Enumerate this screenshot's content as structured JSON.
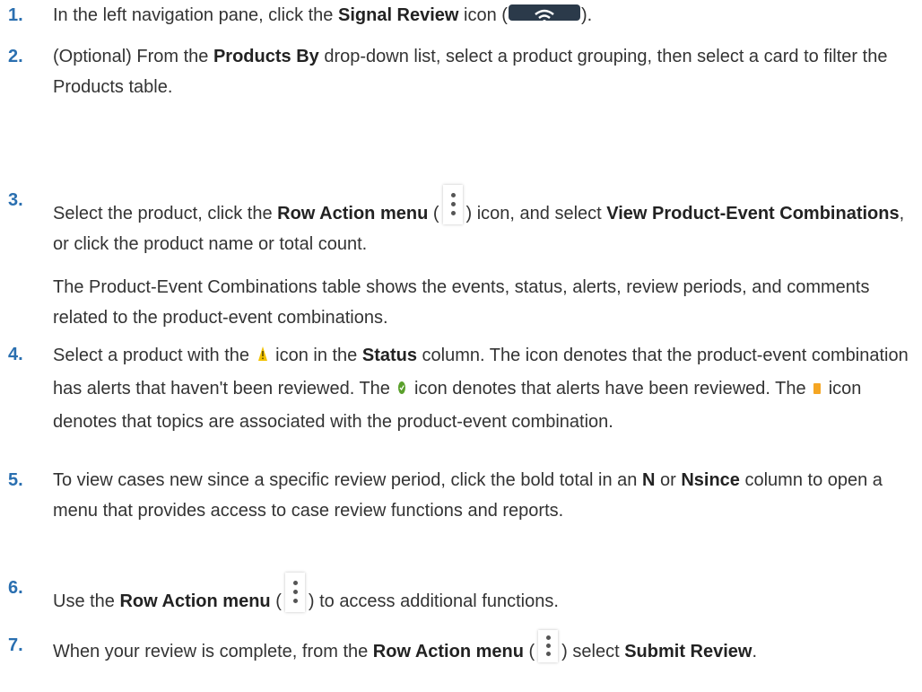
{
  "steps": [
    {
      "num": "1.",
      "t1": "In the left navigation pane, click the ",
      "b1": "Signal Review",
      "t2": " icon (",
      "t3": ")."
    },
    {
      "num": "2.",
      "t1": "(Optional) From the ",
      "b1": "Products By",
      "t2": " drop-down list, select a product grouping, then select a card to filter the Products table."
    },
    {
      "num": "3.",
      "t1": "Select the product, click the ",
      "b1": "Row Action menu",
      "t2": " (",
      "t3": ") icon, and select ",
      "b2": "View Product-Event Combinations",
      "t4": ", or click the product name or total count.",
      "para": "The Product-Event Combinations table shows the events, status, alerts, review periods, and comments related to the product-event combinations."
    },
    {
      "num": "4.",
      "t1": "Select a product with the ",
      "t2": " icon in the ",
      "b1": "Status",
      "t3": " column. The icon denotes that the product-event combination has alerts that haven't been reviewed. The ",
      "t4": " icon denotes that alerts have been reviewed. The ",
      "t5": " icon denotes that topics are associated with the product-event combination."
    },
    {
      "num": "5.",
      "t1": "To view cases new since a specific review period, click the bold total in an ",
      "b1": "N",
      "t2": " or ",
      "b2": "Nsince",
      "t3": " column to open a menu that provides access to case review functions and reports."
    },
    {
      "num": "6.",
      "t1": "Use the ",
      "b1": "Row Action menu",
      "t2": " (",
      "t3": ") to access additional functions."
    },
    {
      "num": "7.",
      "t1": "When your review is complete, from the ",
      "b1": "Row Action menu",
      "t2": " (",
      "t3": ") select ",
      "b2": "Submit Review",
      "t4": "."
    }
  ],
  "icons": {
    "signal": "signal-review-icon",
    "kebab": "row-action-menu-icon",
    "warning": "alert-warning-icon",
    "reviewed": "reviewed-check-icon",
    "topic": "topic-icon"
  },
  "colors": {
    "step_number": "#2a6fb0",
    "warning": "#f2c200",
    "reviewed": "#5aa02c",
    "topic": "#f5a623"
  }
}
